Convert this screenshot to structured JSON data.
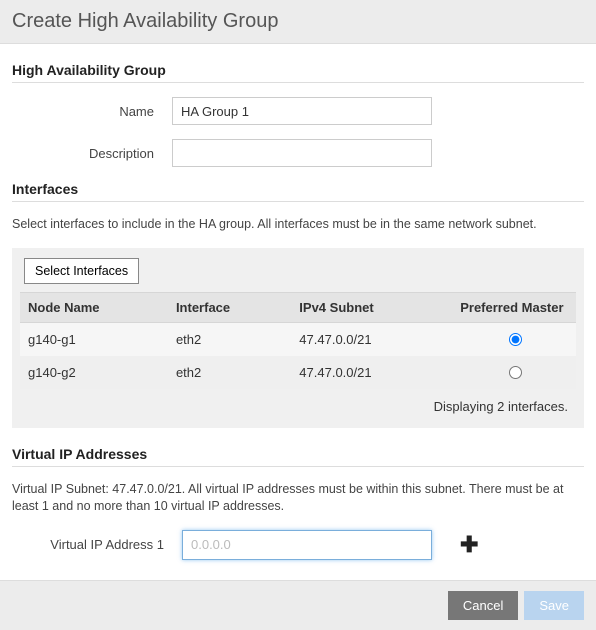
{
  "header": {
    "title": "Create High Availability Group"
  },
  "ha_group": {
    "section_title": "High Availability Group",
    "name_label": "Name",
    "name_value": "HA Group 1",
    "desc_label": "Description",
    "desc_value": ""
  },
  "interfaces": {
    "section_title": "Interfaces",
    "hint": "Select interfaces to include in the HA group. All interfaces must be in the same network subnet.",
    "select_button": "Select Interfaces",
    "columns": {
      "node": "Node Name",
      "iface": "Interface",
      "subnet": "IPv4 Subnet",
      "master": "Preferred Master"
    },
    "rows": [
      {
        "node": "g140-g1",
        "iface": "eth2",
        "subnet": "47.47.0.0/21",
        "master": true
      },
      {
        "node": "g140-g2",
        "iface": "eth2",
        "subnet": "47.47.0.0/21",
        "master": false
      }
    ],
    "footer": "Displaying 2 interfaces."
  },
  "vip": {
    "section_title": "Virtual IP Addresses",
    "hint": "Virtual IP Subnet: 47.47.0.0/21. All virtual IP addresses must be within this subnet. There must be at least 1 and no more than 10 virtual IP addresses.",
    "label1": "Virtual IP Address 1",
    "placeholder": "0.0.0.0",
    "value": "",
    "plus": "✚"
  },
  "footer": {
    "cancel": "Cancel",
    "save": "Save"
  }
}
